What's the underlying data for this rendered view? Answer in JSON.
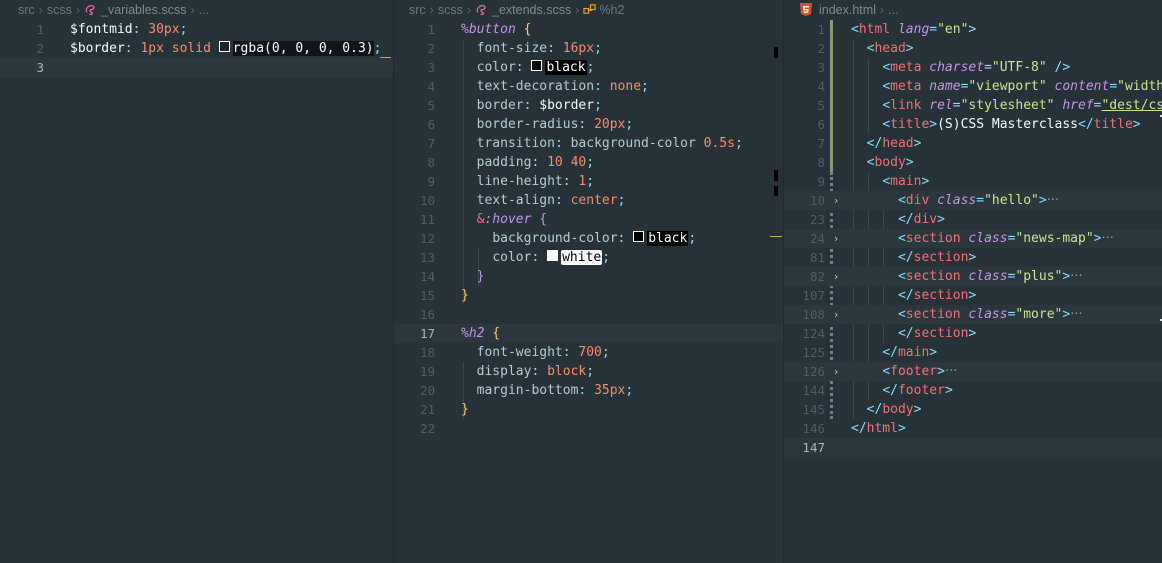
{
  "colors": {
    "editor_bg": "#263238",
    "git_added": "#8b9a6c",
    "git_modified": "#6e7d9c"
  },
  "pane1": {
    "breadcrumb": {
      "folder1": "src",
      "folder2": "scss",
      "file": "_variables.scss",
      "more": "..."
    },
    "lines": [
      {
        "n": "1"
      },
      {
        "n": "2"
      },
      {
        "n": "3"
      }
    ],
    "code": {
      "l1_var": "$fontmid",
      "l1_colon": ": ",
      "l1_val": "30px",
      "l1_semi": ";",
      "l2_var": "$border",
      "l2_colon": ": ",
      "l2_num": "1px",
      "l2_kw": " solid ",
      "l2_rgba": "rgba(0, 0, 0, 0.3)",
      "l2_semi": ";"
    }
  },
  "pane2": {
    "breadcrumb": {
      "folder1": "src",
      "folder2": "scss",
      "file": "_extends.scss",
      "symbol": "%h2"
    },
    "code": {
      "sel_button": "%button",
      "ob": " {",
      "p_fontsize": "font-size",
      "v_fontsize": "16px",
      "p_color": "color",
      "v_color_black": "black",
      "p_textdec": "text-decoration",
      "v_textdec": "none",
      "p_border": "border",
      "v_border": "$border",
      "p_radius": "border-radius",
      "v_radius": "20px",
      "p_transition": "transition",
      "v_transition_a": "background-color ",
      "v_transition_b": "0.5s",
      "p_padding": "padding",
      "v_padding": "10 40",
      "p_lineheight": "line-height",
      "v_lineheight": "1",
      "p_textalign": "text-align",
      "v_textalign": "center",
      "hover_amp": "&",
      "hover_sel": ":hover",
      "hover_ob": " {",
      "p_bgcolor": "background-color",
      "v_bgcolor": "black",
      "p_color2": "color",
      "v_color_white": "white",
      "cb_inner": "}",
      "cb": "}",
      "sel_h2": "%h2",
      "ob2": " {",
      "p_fontweight": "font-weight",
      "v_fontweight": "700",
      "p_display": "display",
      "v_display": "block",
      "p_marginbottom": "margin-bottom",
      "v_marginbottom": "35px",
      "cb2": "}",
      "colon": ": ",
      "semi": ";"
    },
    "line_numbers": [
      "1",
      "2",
      "3",
      "4",
      "5",
      "6",
      "7",
      "8",
      "9",
      "10",
      "11",
      "12",
      "13",
      "14",
      "15",
      "16",
      "17",
      "18",
      "19",
      "20",
      "21",
      "22"
    ]
  },
  "pane3": {
    "breadcrumb": {
      "file": "index.html",
      "more": "..."
    },
    "line_numbers": [
      "1",
      "2",
      "3",
      "4",
      "5",
      "6",
      "7",
      "8",
      "9",
      "10",
      "23",
      "24",
      "81",
      "82",
      "107",
      "108",
      "124",
      "125",
      "126",
      "144",
      "145",
      "146",
      "147"
    ],
    "code": {
      "lt": "<",
      "gt": ">",
      "close_lt": "</",
      "selfclose": " />",
      "eq": "=",
      "ellipsis": "···",
      "html": "html",
      "lang": "lang",
      "lang_val": "\"en\"",
      "head": "head",
      "meta": "meta",
      "charset": "charset",
      "charset_val": "\"UTF-8\"",
      "name": "name",
      "viewport": "\"viewport\"",
      "content": "content",
      "content_val": "\"width=",
      "link": "link",
      "rel": "rel",
      "stylesheet": "\"stylesheet\"",
      "href": "href",
      "href_val": "\"dest/css",
      "title": "title",
      "title_text": "(S)CSS Masterclass",
      "body": "body",
      "main": "main",
      "div": "div",
      "class": "class",
      "hello": "\"hello\"",
      "section": "section",
      "news_map": "\"news-map\"",
      "plus": "\"plus\"",
      "more": "\"more\"",
      "footer": "footer"
    }
  }
}
